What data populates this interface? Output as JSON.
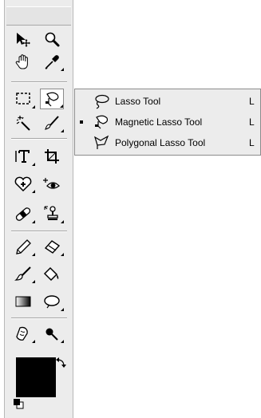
{
  "toolbox": {
    "tools": [
      {
        "name": "move-tool",
        "icon": "move-arrow-icon"
      },
      {
        "name": "zoom-tool",
        "icon": "magnifier-icon"
      },
      {
        "name": "hand-tool",
        "icon": "hand-icon"
      },
      {
        "name": "eyedropper-tool",
        "icon": "eyedropper-icon"
      },
      {
        "name": "marquee-tool",
        "icon": "rect-marquee-icon"
      },
      {
        "name": "lasso-tool",
        "icon": "magnetic-lasso-icon",
        "active": true
      },
      {
        "name": "magic-wand-tool",
        "icon": "magic-wand-icon"
      },
      {
        "name": "brush-tool",
        "icon": "brush-icon"
      },
      {
        "name": "type-tool",
        "icon": "type-icon"
      },
      {
        "name": "crop-tool",
        "icon": "crop-icon"
      },
      {
        "name": "healing-brush-tool",
        "icon": "healing-heart-icon"
      },
      {
        "name": "red-eye-tool",
        "icon": "red-eye-icon"
      },
      {
        "name": "spot-healing-tool",
        "icon": "bandage-icon"
      },
      {
        "name": "clone-stamp-tool",
        "icon": "stamp-icon"
      },
      {
        "name": "pencil-tool",
        "icon": "pencil-icon"
      },
      {
        "name": "eraser-tool",
        "icon": "eraser-icon"
      },
      {
        "name": "smudge-tool",
        "icon": "smudge-icon"
      },
      {
        "name": "paint-bucket-tool",
        "icon": "paint-bucket-icon"
      },
      {
        "name": "gradient-tool",
        "icon": "gradient-icon"
      },
      {
        "name": "shape-tool",
        "icon": "ellipse-shape-icon"
      },
      {
        "name": "sponge-tool",
        "icon": "sponge-icon"
      },
      {
        "name": "burn-tool",
        "icon": "burn-icon"
      }
    ],
    "colors": {
      "foreground": "#000000",
      "background": "#ffffff"
    }
  },
  "flyout": {
    "items": [
      {
        "label": "Lasso Tool",
        "shortcut": "L",
        "icon": "lasso-icon",
        "selected": false
      },
      {
        "label": "Magnetic Lasso Tool",
        "shortcut": "L",
        "icon": "magnetic-lasso-icon",
        "selected": true
      },
      {
        "label": "Polygonal Lasso Tool",
        "shortcut": "L",
        "icon": "polygonal-lasso-icon",
        "selected": false
      }
    ]
  }
}
